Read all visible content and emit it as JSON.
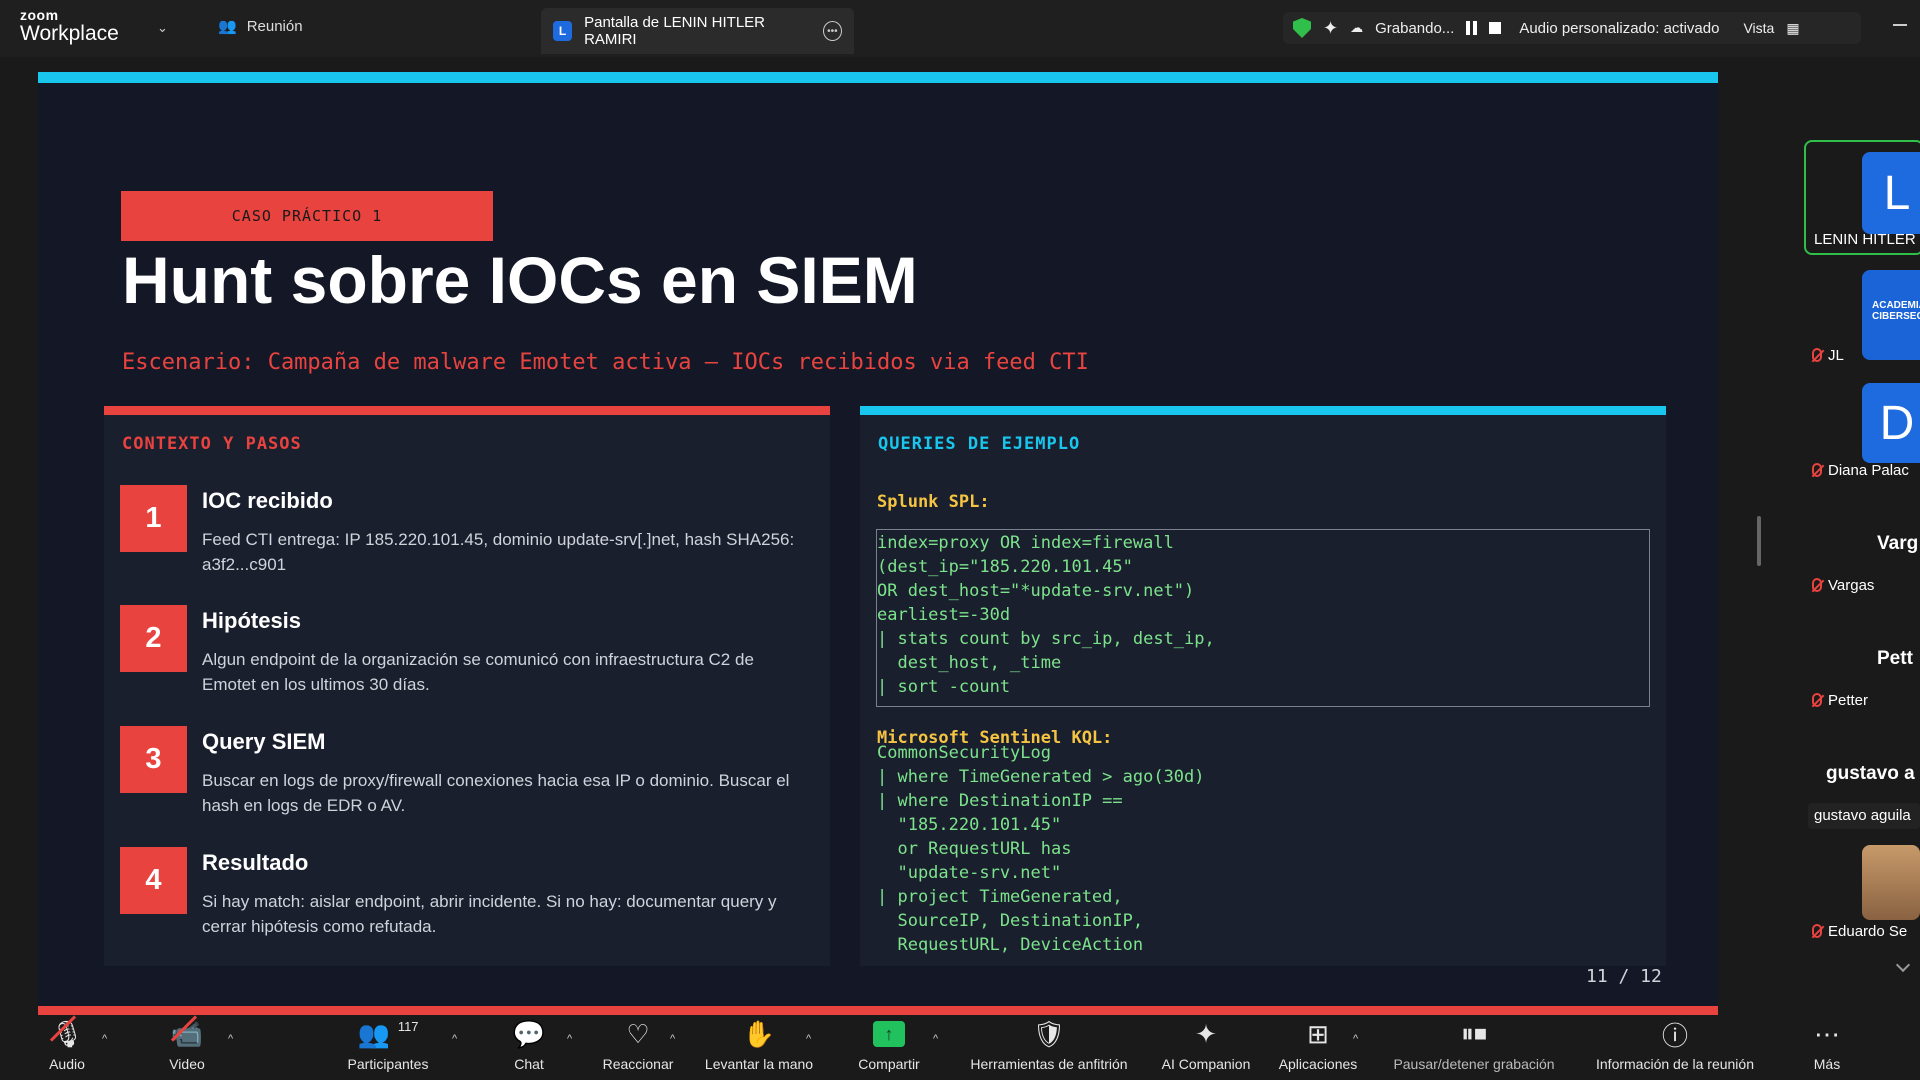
{
  "topbar": {
    "brand_top": "zoom",
    "brand_bottom": "Workplace",
    "meeting_tab": "Reunión",
    "share_tab_badge": "L",
    "share_tab_title": "Pantalla de LENIN HITLER RAMIRI",
    "recording_label": "Grabando...",
    "audio_label": "Audio personalizado: activado",
    "view_label": "Vista"
  },
  "slide": {
    "badge": "CASO PRÁCTICO 1",
    "title": "Hunt sobre IOCs en SIEM",
    "scenario": "Escenario: Campaña de malware Emotet activa — IOCs recibidos via feed CTI",
    "left_heading": "CONTEXTO Y PASOS",
    "steps": [
      {
        "num": "1",
        "title": "IOC recibido",
        "desc": "Feed CTI entrega: IP 185.220.101.45, dominio update-srv[.]net, hash SHA256: a3f2...c901"
      },
      {
        "num": "2",
        "title": "Hipótesis",
        "desc": "Algun endpoint de la organización se comunicó con infraestructura C2 de Emotet en los ultimos 30 días."
      },
      {
        "num": "3",
        "title": "Query SIEM",
        "desc": "Buscar en logs de proxy/firewall conexiones hacia esa IP o dominio. Buscar el hash en logs de EDR o AV."
      },
      {
        "num": "4",
        "title": "Resultado",
        "desc": "Si hay match: aislar endpoint, abrir incidente. Si no hay: documentar query y cerrar hipótesis como refutada."
      }
    ],
    "right_heading": "QUERIES DE EJEMPLO",
    "splunk_label": "Splunk SPL:",
    "splunk_code": "index=proxy OR index=firewall\n(dest_ip=\"185.220.101.45\"\nOR dest_host=\"*update-srv.net\")\nearliest=-30d\n| stats count by src_ip, dest_ip,\n  dest_host, _time\n| sort -count",
    "kql_label": "Microsoft Sentinel KQL:",
    "kql_code": "CommonSecurityLog\n| where TimeGenerated > ago(30d)\n| where DestinationIP ==\n  \"185.220.101.45\"\n  or RequestURL has\n  \"update-srv.net\"\n| project TimeGenerated,\n  SourceIP, DestinationIP,\n  RequestURL, DeviceAction",
    "page": "11 / 12"
  },
  "participants": [
    {
      "initial": "L",
      "name": "LENIN HITLER",
      "muted": false
    },
    {
      "initial": "",
      "name": "JL",
      "muted": true,
      "logo_text": "ACADEMIA CIBERSEGU"
    },
    {
      "initial": "D",
      "name": "Diana Palac",
      "muted": true
    },
    {
      "initial": "",
      "name": "Vargas",
      "muted": true,
      "header": "Varg"
    },
    {
      "initial": "",
      "name": "Petter",
      "muted": true,
      "header": "Pett"
    },
    {
      "initial": "",
      "name": "gustavo aguila",
      "muted": false,
      "header": "gustavo a"
    },
    {
      "initial": "",
      "name": "Eduardo Se",
      "muted": true
    }
  ],
  "toolbar": {
    "audio": "Audio",
    "video": "Video",
    "participants": "Participantes",
    "participants_count": "117",
    "chat": "Chat",
    "react": "Reaccionar",
    "raise_hand": "Levantar la mano",
    "share": "Compartir",
    "host_tools": "Herramientas de anfitrión",
    "ai": "AI Companion",
    "apps": "Aplicaciones",
    "pause_rec": "Pausar/detener grabación",
    "info": "Información de la reunión",
    "more": "Más"
  },
  "colors": {
    "accent_red": "#e8433f",
    "accent_cyan": "#18c6ee",
    "code_green": "#7ce38b",
    "code_label": "#f5c542",
    "share_green": "#21c25e"
  }
}
